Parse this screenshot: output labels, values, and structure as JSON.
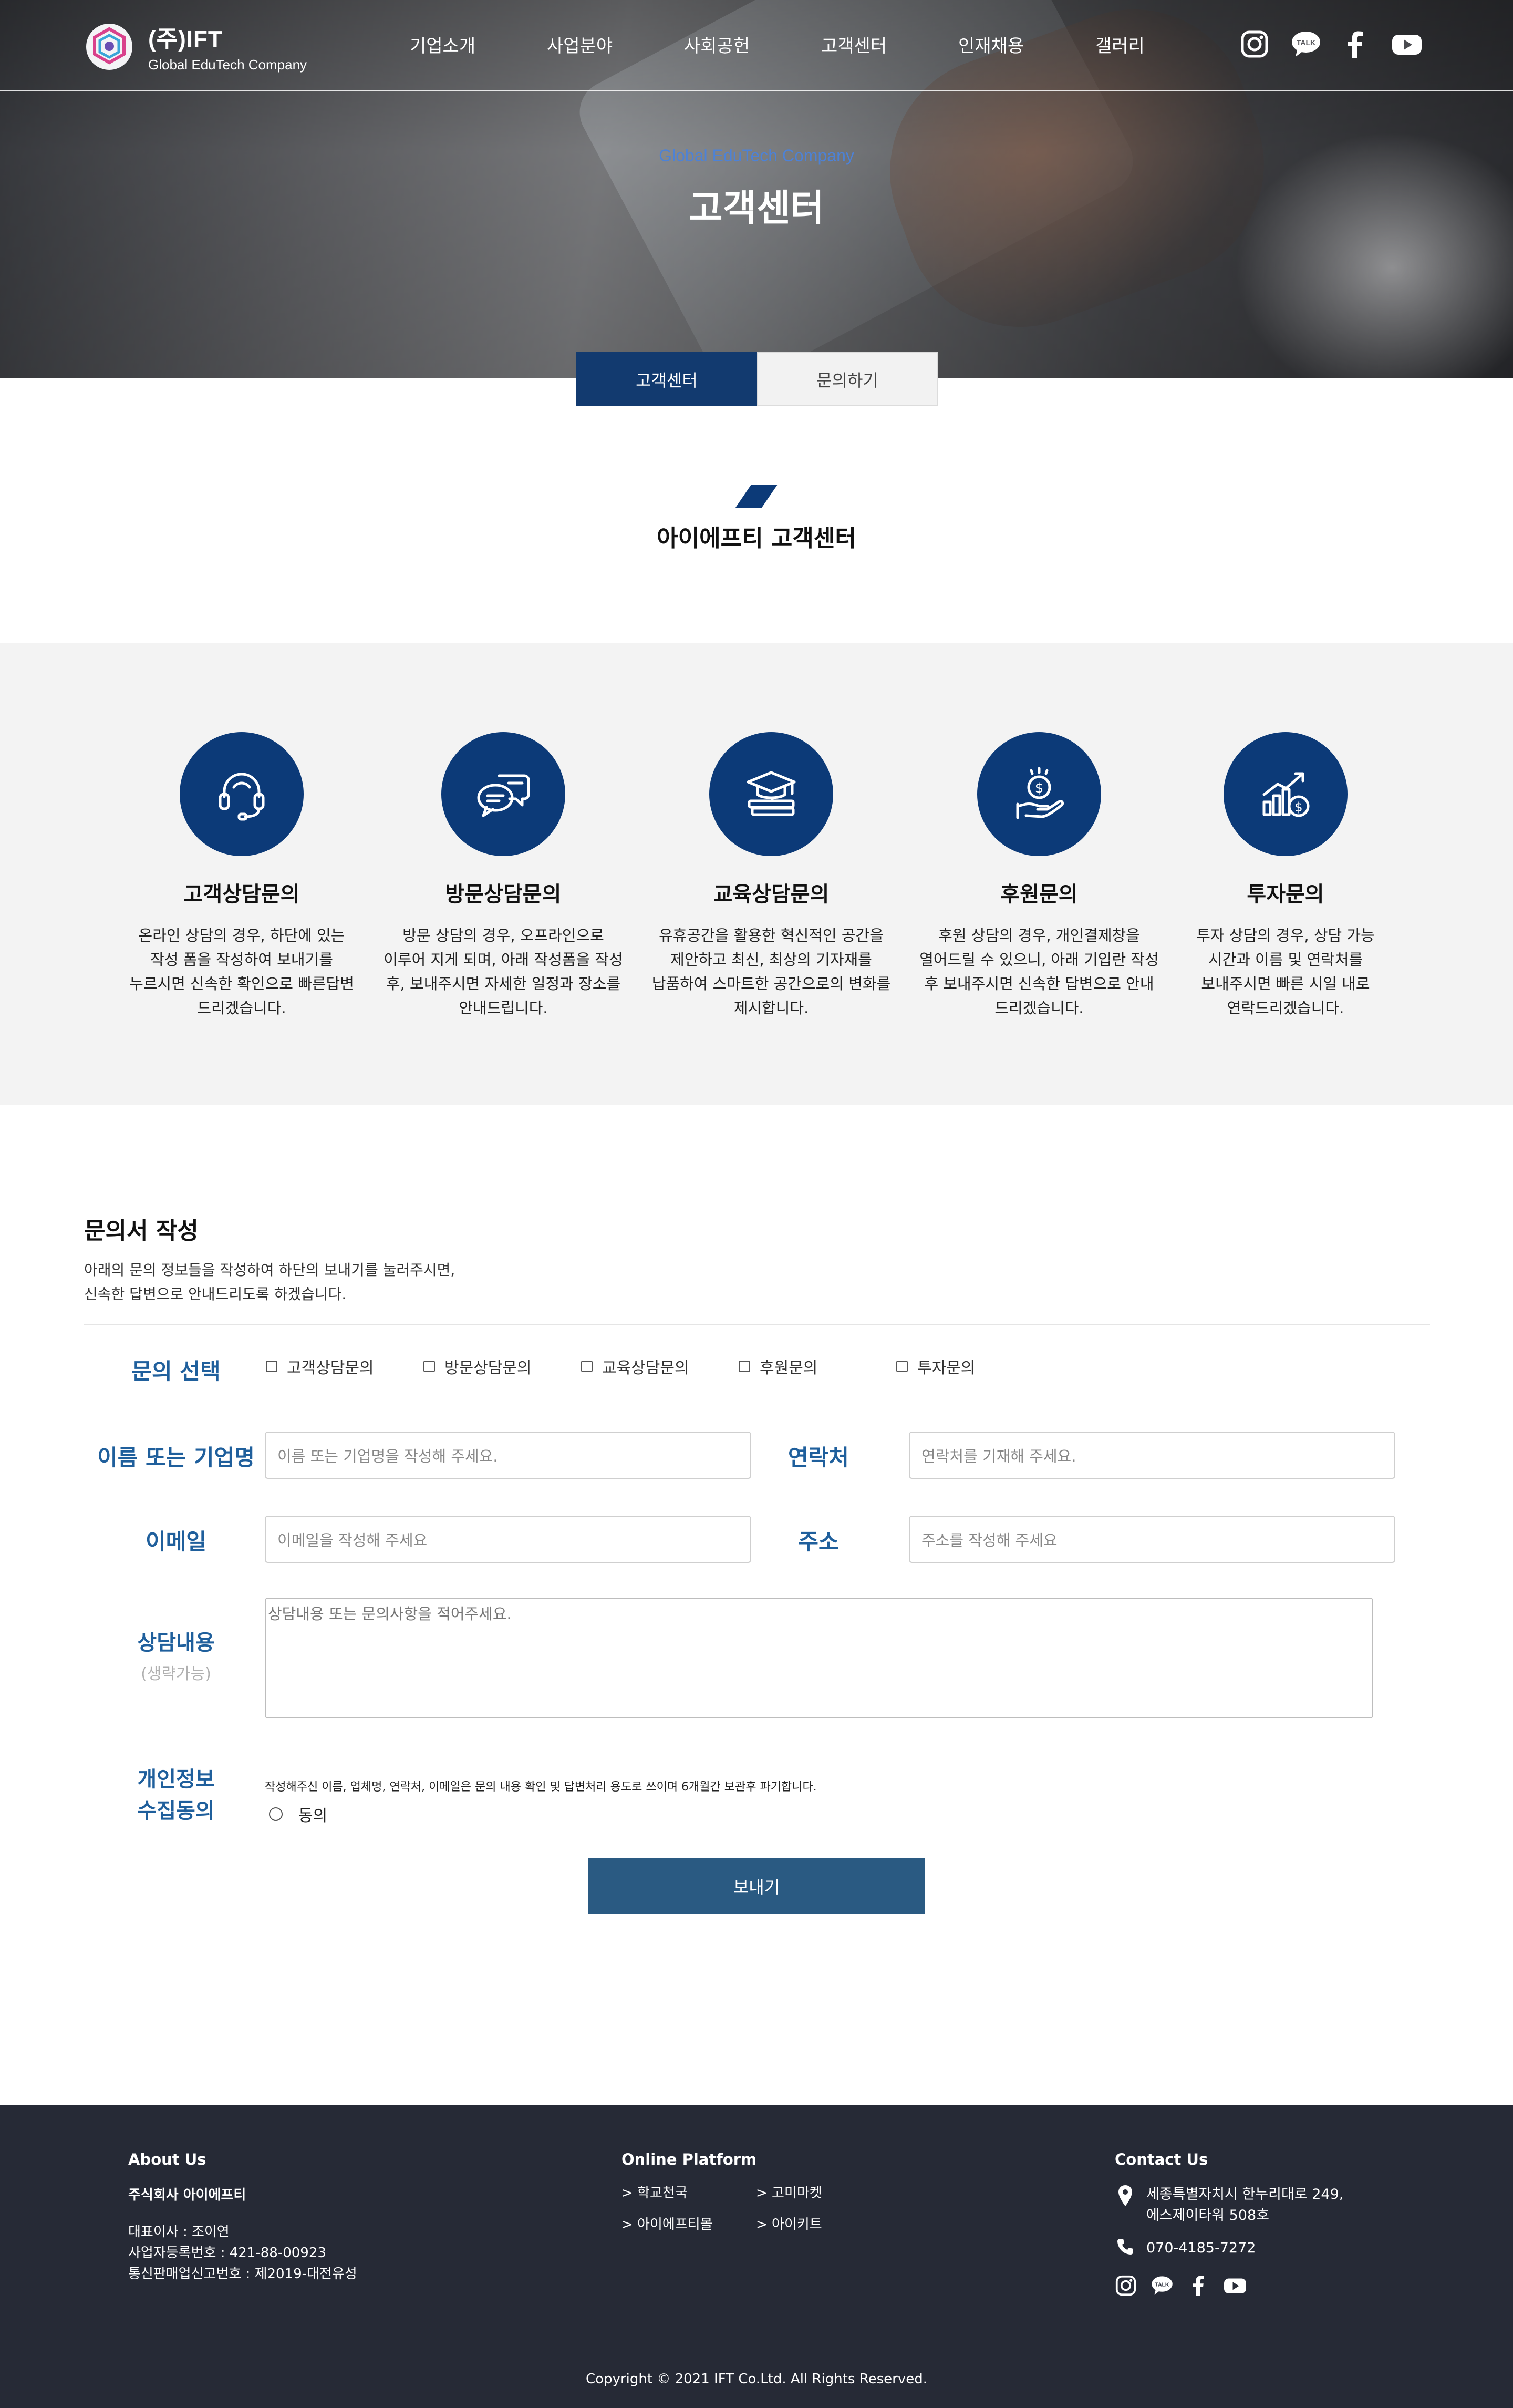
{
  "header": {
    "company_name": "(주)IFT",
    "company_tagline": "Global EduTech Company",
    "nav": [
      {
        "label": "기업소개"
      },
      {
        "label": "사업분야"
      },
      {
        "label": "사회공헌"
      },
      {
        "label": "고객센터"
      },
      {
        "label": "인재채용"
      },
      {
        "label": "갤러리"
      }
    ],
    "social_icons": [
      "instagram-icon",
      "kakaotalk-icon",
      "facebook-icon",
      "youtube-icon"
    ]
  },
  "hero": {
    "subtitle": "Global EduTech Company",
    "title": "고객센터"
  },
  "tabs": [
    {
      "label": "고객센터",
      "active": true
    },
    {
      "label": "문의하기",
      "active": false
    }
  ],
  "intro": {
    "title": "아이에프티 고객센터"
  },
  "services": [
    {
      "icon": "headset-icon",
      "title": "고객상담문의",
      "desc": [
        "온라인 상담의 경우, 하단에 있는",
        "작성 폼을 작성하여 보내기를",
        "누르시면 신속한 확인으로 빠른답변",
        "드리겠습니다."
      ]
    },
    {
      "icon": "chat-bubbles-icon",
      "title": "방문상담문의",
      "desc": [
        "방문 상담의 경우, 오프라인으로",
        "이루어 지게 되며, 아래 작성폼을 작성",
        "후, 보내주시면 자세한 일정과 장소를",
        "안내드립니다."
      ]
    },
    {
      "icon": "graduation-cap-icon",
      "title": "교육상담문의",
      "desc": [
        "유휴공간을 활용한 혁신적인 공간을",
        "제안하고 최신, 최상의 기자재를",
        "납품하여 스마트한 공간으로의 변화를",
        "제시합니다."
      ]
    },
    {
      "icon": "donation-hand-icon",
      "title": "후원문의",
      "desc": [
        "후원 상담의 경우, 개인결제창을",
        "열어드릴 수 있으니, 아래 기입란 작성",
        "후 보내주시면 신속한 답변으로 안내",
        "드리겠습니다."
      ]
    },
    {
      "icon": "growth-chart-icon",
      "title": "투자문의",
      "desc": [
        "투자 상담의 경우, 상담 가능",
        "시간과 이름 및 연락처를",
        "보내주시면 빠른 시일 내로",
        "연락드리겠습니다."
      ]
    }
  ],
  "form": {
    "heading": "문의서 작성",
    "intro_lines": [
      "아래의 문의 정보들을 작성하여 하단의 보내기를 눌러주시면,",
      "신속한 답변으로 안내드리도록 하겠습니다."
    ],
    "inquiry_label": "문의 선택",
    "inquiry_options": [
      "고객상담문의",
      "방문상담문의",
      "교육상담문의",
      "후원문의",
      "투자문의"
    ],
    "name_label": "이름 또는 기업명",
    "name_placeholder": "이름 또는 기업명을 작성해 주세요.",
    "phone_label": "연락처",
    "phone_placeholder": "연락처를 기재해 주세요.",
    "email_label": "이메일",
    "email_placeholder": "이메일을 작성해 주세요",
    "address_label": "주소",
    "address_placeholder": "주소를 작성해 주세요",
    "content_label": "상담내용",
    "content_optional": "(생략가능)",
    "content_placeholder": "상담내용 또는 문의사항을 적어주세요.",
    "privacy_label_1": "개인정보",
    "privacy_label_2": "수집동의",
    "privacy_notice": "작성해주신 이름, 업체명, 연락처, 이메일은 문의 내용 확인 및 답변처리 용도로 쓰이며 6개월간 보관후 파기합니다.",
    "agree_label": "동의",
    "submit_label": "보내기"
  },
  "footer": {
    "about": {
      "heading": "About Us",
      "company": "주식회사 아이에프티",
      "lines": [
        "대표이사 : 조이연",
        "사업자등록번호 : 421-88-00923",
        "통신판매업신고번호 : 제2019-대전유성"
      ]
    },
    "platform": {
      "heading": "Online Platform",
      "links": [
        "> 학교천국",
        "> 고미마켓",
        "> 아이에프티몰",
        "> 아이키트"
      ]
    },
    "contact": {
      "heading": "Contact Us",
      "address_lines": [
        "세종특별자치시 한누리대로 249,",
        "에스제이타워 508호"
      ],
      "phone": "070-4185-7272"
    },
    "copyright": "Copyright © 2021 IFT Co.Ltd. All Rights Reserved."
  },
  "colors": {
    "navy": "#0c3a78",
    "label_blue": "#1f5f9c",
    "submit": "#2a5a82",
    "footer_bg": "#262a36",
    "section_bg": "#f3f3f3"
  }
}
